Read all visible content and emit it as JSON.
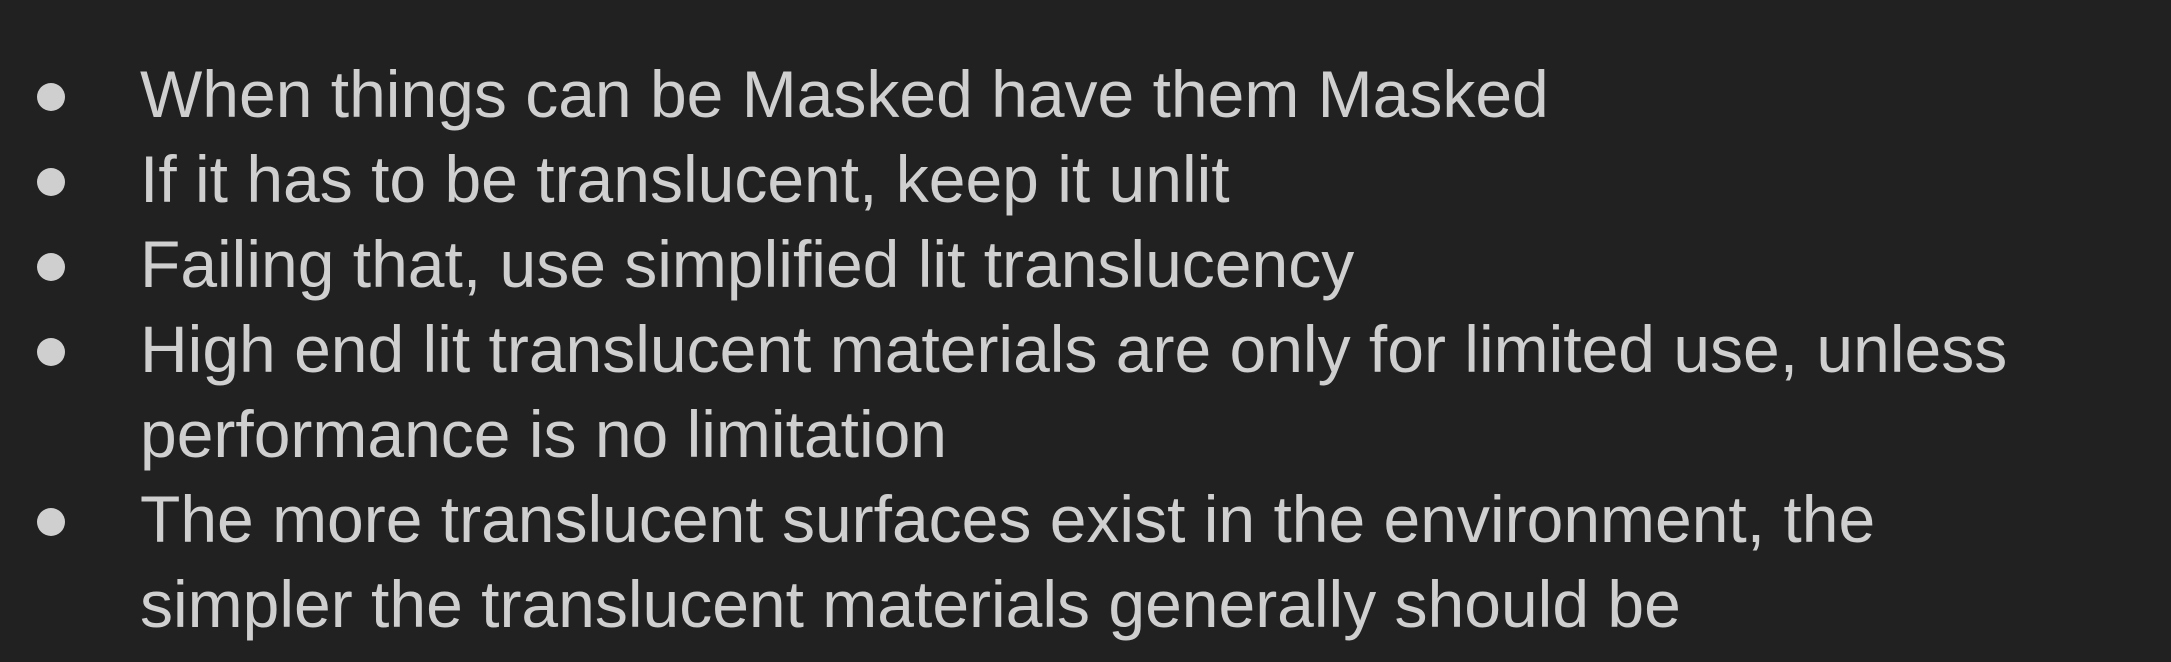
{
  "bullets": [
    {
      "lines": [
        "When things can be Masked have them Masked"
      ]
    },
    {
      "lines": [
        "If it has to be translucent, keep it unlit"
      ]
    },
    {
      "lines": [
        "Failing that, use simplified lit translucency"
      ]
    },
    {
      "lines": [
        "High end lit translucent materials are only for limited use, unless",
        "performance is no limitation"
      ]
    },
    {
      "lines": [
        "The more translucent surfaces exist in the environment, the",
        "simpler the translucent materials generally should be"
      ]
    }
  ],
  "colors": {
    "background": "#212121",
    "text": "#cfcfcf"
  }
}
